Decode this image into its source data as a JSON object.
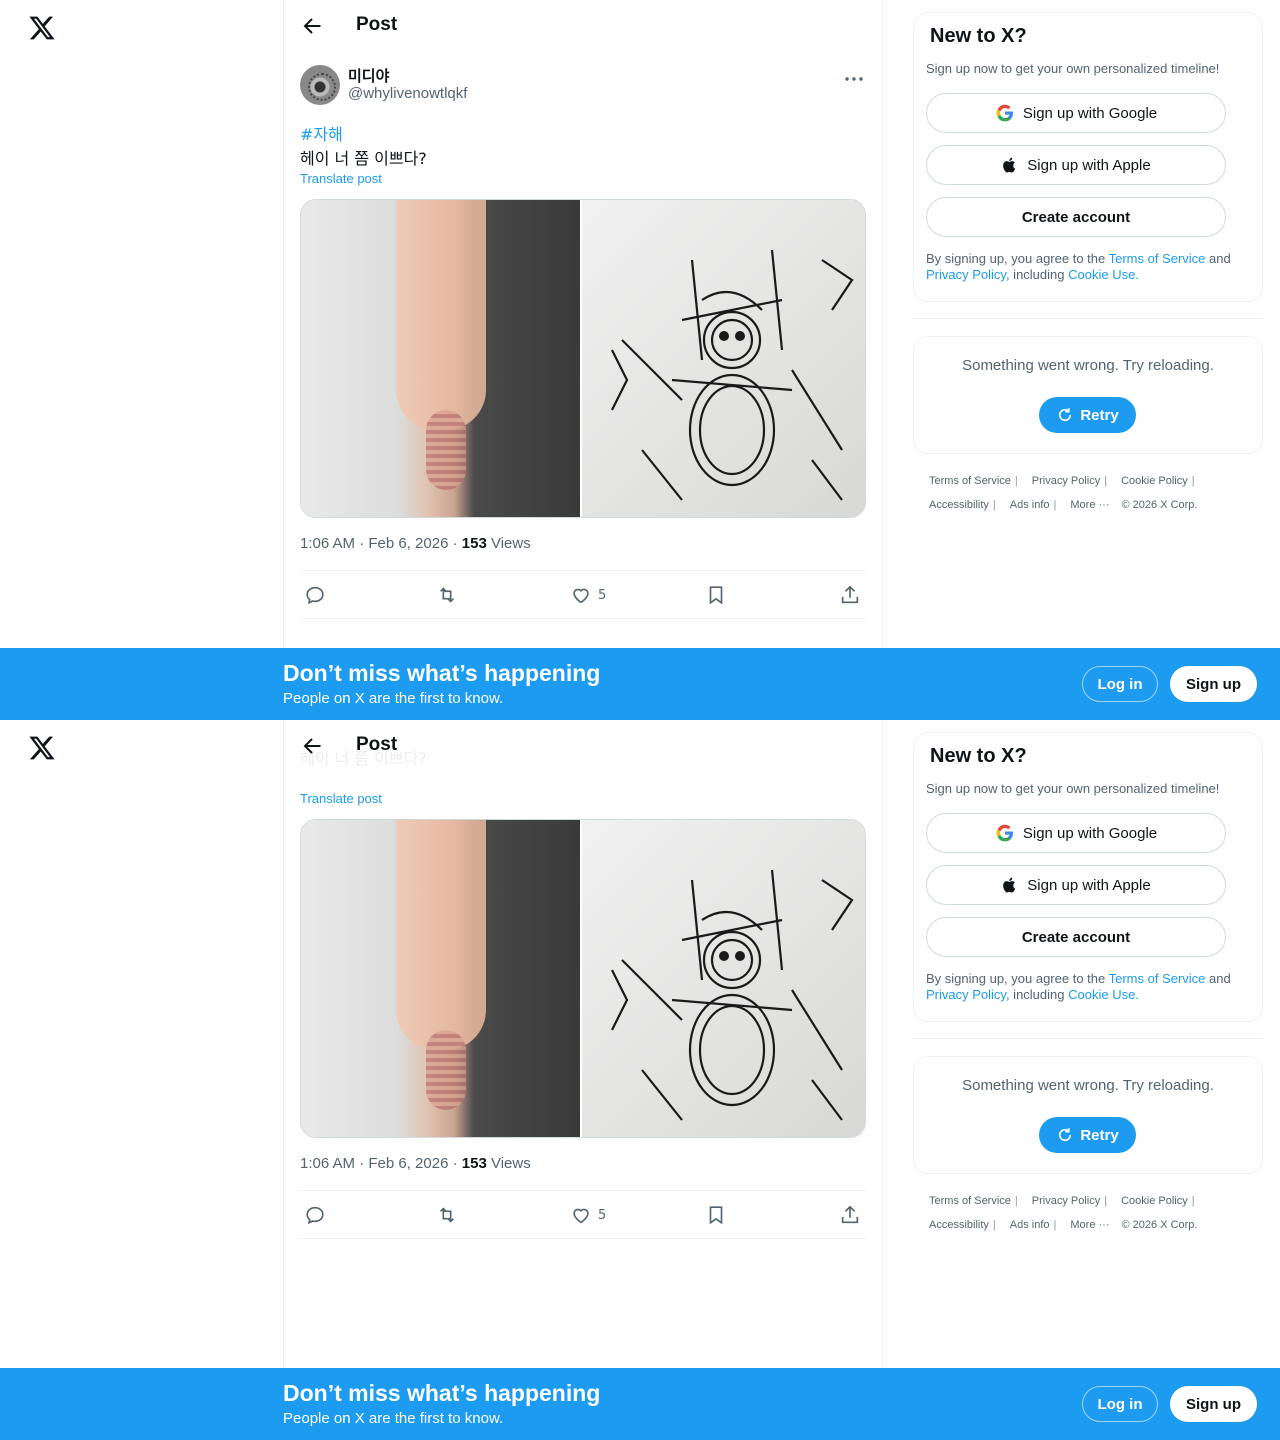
{
  "header": {
    "title": "Post"
  },
  "post": {
    "display_name": "미디야",
    "handle": "@whylivenowtlqkf",
    "hashtag": "#자해",
    "text": "헤이 너 쫌 이쁘다?",
    "translate": "Translate post",
    "time": "1:06 AM · Feb 6, 2026 · ",
    "views_count": "153",
    "views_label": " Views",
    "likes": "5"
  },
  "signup_card": {
    "title": "New to X?",
    "subtitle": "Sign up now to get your own personalized timeline!",
    "google": "Sign up with Google",
    "apple": "Sign up with Apple",
    "create": "Create account",
    "legal_pre": "By signing up, you agree to the ",
    "tos": "Terms of Service",
    "and": " and ",
    "privacy": "Privacy Policy",
    "including": ", including ",
    "cookie": "Cookie Use."
  },
  "error_card": {
    "message": "Something went wrong. Try reloading.",
    "retry": "Retry"
  },
  "footer": {
    "tos": "Terms of Service",
    "privacy": "Privacy Policy",
    "cookie": "Cookie Policy",
    "accessibility": "Accessibility",
    "ads": "Ads info",
    "more": "More ···",
    "copyright": "© 2026 X Corp."
  },
  "banner": {
    "title": "Don’t miss what’s happening",
    "subtitle": "People on X are the first to know.",
    "login": "Log in",
    "signup": "Sign up"
  },
  "colors": {
    "accent": "#1d9bf0",
    "text": "#0f1419",
    "muted": "#536471"
  }
}
